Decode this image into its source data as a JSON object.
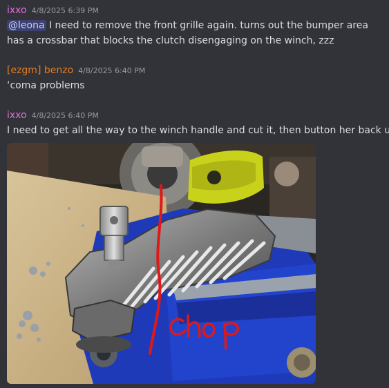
{
  "colors": {
    "background": "#313338",
    "text": "#dbdee1",
    "timestamp": "#949ba4",
    "ixxo": "#e06de0",
    "benzo": "#e67e22",
    "mention_bg": "#3c4270",
    "mention_text": "#c9cdfb",
    "annotation_red": "#e01818"
  },
  "messages": [
    {
      "author": "ixxo",
      "timestamp": "4/8/2025 6:39 PM",
      "mention": "@leona",
      "text": " I need to remove the front grille again. turns out the bumper area has a crossbar that blocks the clutch disengaging on the winch, zzz"
    },
    {
      "author": "[ezgm] benzo",
      "timestamp": "4/8/2025 6:40 PM",
      "text": "‘coma problems"
    },
    {
      "author": "ixxo",
      "timestamp": "4/8/2025 6:40 PM",
      "text": "I need to get all the way to the winch handle and cut it, then button her back up",
      "attachment": {
        "annotation_text": "chop",
        "subject": "winch-handle-in-vise-photo"
      }
    }
  ]
}
